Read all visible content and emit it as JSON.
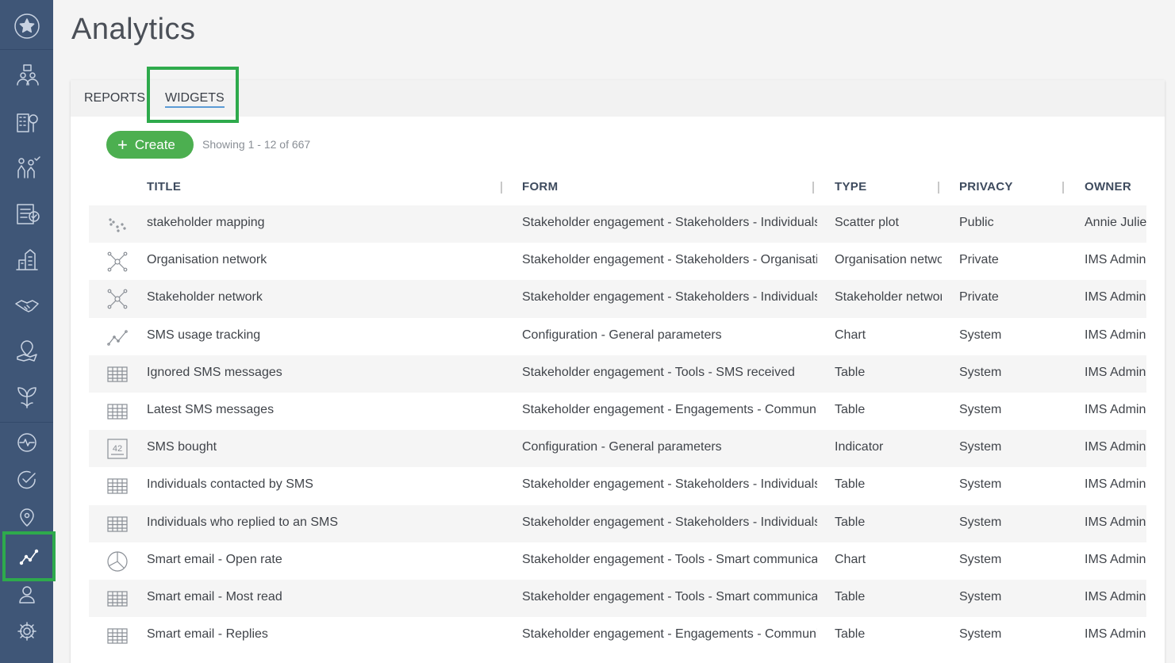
{
  "page": {
    "title": "Analytics"
  },
  "tabs": [
    {
      "label": "REPORTS",
      "active": false
    },
    {
      "label": "WIDGETS",
      "active": true
    }
  ],
  "toolbar": {
    "create_label": "Create",
    "showing_text": "Showing 1 - 12 of 667"
  },
  "table": {
    "columns": [
      "TITLE",
      "FORM",
      "TYPE",
      "PRIVACY",
      "OWNER"
    ],
    "rows": [
      {
        "icon": "scatter-icon",
        "title": "stakeholder mapping",
        "form": "Stakeholder engagement - Stakeholders - Individuals",
        "type": "Scatter plot",
        "privacy": "Public",
        "owner": "Annie Julien"
      },
      {
        "icon": "network-icon",
        "title": "Organisation network",
        "form": "Stakeholder engagement - Stakeholders - Organisations",
        "type": "Organisation network",
        "privacy": "Private",
        "owner": "IMS Admin"
      },
      {
        "icon": "network-icon",
        "title": "Stakeholder network",
        "form": "Stakeholder engagement - Stakeholders - Individuals",
        "type": "Stakeholder network",
        "privacy": "Private",
        "owner": "IMS Admin"
      },
      {
        "icon": "line-chart-icon",
        "title": "SMS usage tracking",
        "form": "Configuration - General parameters",
        "type": "Chart",
        "privacy": "System",
        "owner": "IMS Admin"
      },
      {
        "icon": "table-icon",
        "title": "Ignored SMS messages",
        "form": "Stakeholder engagement - Tools - SMS received",
        "type": "Table",
        "privacy": "System",
        "owner": "IMS Admin"
      },
      {
        "icon": "table-icon",
        "title": "Latest SMS messages",
        "form": "Stakeholder engagement - Engagements - Communications",
        "type": "Table",
        "privacy": "System",
        "owner": "IMS Admin"
      },
      {
        "icon": "indicator-icon",
        "title": "SMS bought",
        "form": "Configuration - General parameters",
        "type": "Indicator",
        "privacy": "System",
        "owner": "IMS Admin"
      },
      {
        "icon": "table-icon",
        "title": "Individuals contacted by SMS",
        "form": "Stakeholder engagement - Stakeholders - Individuals",
        "type": "Table",
        "privacy": "System",
        "owner": "IMS Admin"
      },
      {
        "icon": "table-icon",
        "title": "Individuals who replied to an SMS",
        "form": "Stakeholder engagement - Stakeholders - Individuals",
        "type": "Table",
        "privacy": "System",
        "owner": "IMS Admin"
      },
      {
        "icon": "pie-chart-icon",
        "title": "Smart email - Open rate",
        "form": "Stakeholder engagement - Tools - Smart communications",
        "type": "Chart",
        "privacy": "System",
        "owner": "IMS Admin"
      },
      {
        "icon": "table-icon",
        "title": "Smart email - Most read",
        "form": "Stakeholder engagement - Tools - Smart communications",
        "type": "Table",
        "privacy": "System",
        "owner": "IMS Admin"
      },
      {
        "icon": "table-icon",
        "title": "Smart email - Replies",
        "form": "Stakeholder engagement - Engagements - Communications",
        "type": "Table",
        "privacy": "System",
        "owner": "IMS Admin"
      }
    ]
  },
  "indicator_icon_text": "42",
  "sidebar": {
    "items": [
      {
        "icon": "star-icon"
      },
      {
        "icon": "meeting-icon"
      },
      {
        "icon": "building-tree-icon"
      },
      {
        "icon": "people-checklist-icon"
      },
      {
        "icon": "clipboard-check-icon"
      },
      {
        "icon": "community-buildings-icon"
      },
      {
        "icon": "handshake-icon"
      },
      {
        "icon": "map-pin-icon"
      },
      {
        "icon": "leaf-brain-icon"
      },
      {
        "icon": "pulse-icon"
      },
      {
        "icon": "check-circle-icon"
      },
      {
        "icon": "location-icon"
      },
      {
        "icon": "analytics-icon",
        "active": true
      },
      {
        "icon": "user-icon"
      },
      {
        "icon": "settings-icon"
      }
    ]
  }
}
